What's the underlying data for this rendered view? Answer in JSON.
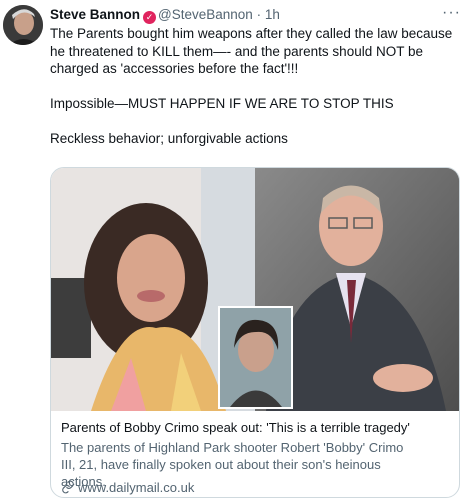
{
  "tweet": {
    "display_name": "Steve Bannon",
    "verified_icon": "verified-badge-icon",
    "handle": "@SteveBannon",
    "dot": "·",
    "time": "1h",
    "more_icon": "more-options-icon",
    "text_paragraphs": [
      "The Parents bought him weapons after they called the law because he threatened to KILL them—- and the parents should NOT be charged as 'accessories before the fact'!!!",
      "Impossible—MUST HAPPEN IF WE ARE TO STOP THIS",
      "Reckless behavior; unforgivable actions"
    ]
  },
  "card": {
    "title": "Parents of Bobby Crimo speak out: 'This is a terrible tragedy'",
    "description": "The parents of Highland Park shooter Robert 'Bobby' Crimo III, 21, have finally spoken out about their son's heinous actions.",
    "link_icon": "link-icon",
    "domain": "www.dailymail.co.uk"
  },
  "colors": {
    "text_primary": "#0f1419",
    "text_secondary": "#536471",
    "border": "#cfd9de",
    "verified_badge": "#e0245e"
  }
}
